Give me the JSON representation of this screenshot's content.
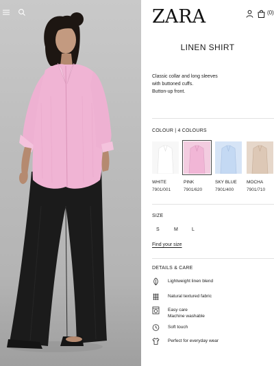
{
  "header": {
    "brand": "ZARA",
    "bag_count": "(0)"
  },
  "product": {
    "title": "LINEN SHIRT",
    "description_lines": [
      "Classic collar and long sleeves",
      "with buttoned cuffs.",
      "Button-up front."
    ]
  },
  "colour": {
    "heading": "COLOUR | 4 COLOURS",
    "options": [
      {
        "name": "WHITE",
        "code": "7901/001",
        "hex": "#f4f4f4",
        "selected": false
      },
      {
        "name": "PINK",
        "code": "7901/620",
        "hex": "#f1b6d6",
        "selected": true
      },
      {
        "name": "SKY BLUE",
        "code": "7901/400",
        "hex": "#c4d9f3",
        "selected": false
      },
      {
        "name": "MOCHA",
        "code": "7901/710",
        "hex": "#ddc8b6",
        "selected": false
      }
    ]
  },
  "size": {
    "heading": "SIZE",
    "options": [
      "S",
      "M",
      "L"
    ],
    "guide_link": "Find your size"
  },
  "details": {
    "heading": "DETAILS & CARE",
    "items": [
      {
        "icon": "leaf-icon",
        "lines": [
          "Lightweight linen blend"
        ]
      },
      {
        "icon": "fabric-grid-icon",
        "lines": [
          "Natural textured fabric"
        ]
      },
      {
        "icon": "washing-machine-icon",
        "lines": [
          "Easy care",
          "Machine washable"
        ]
      },
      {
        "icon": "clock-icon",
        "lines": [
          "Soft touch"
        ]
      },
      {
        "icon": "shirt-icon",
        "lines": [
          "Perfect for everyday wear"
        ]
      }
    ]
  },
  "colors": {
    "photo_bg": "#c2c2c2",
    "shirt": "#f0b4d4",
    "trousers": "#1b1b1b",
    "divider": "#e2e2e2"
  }
}
